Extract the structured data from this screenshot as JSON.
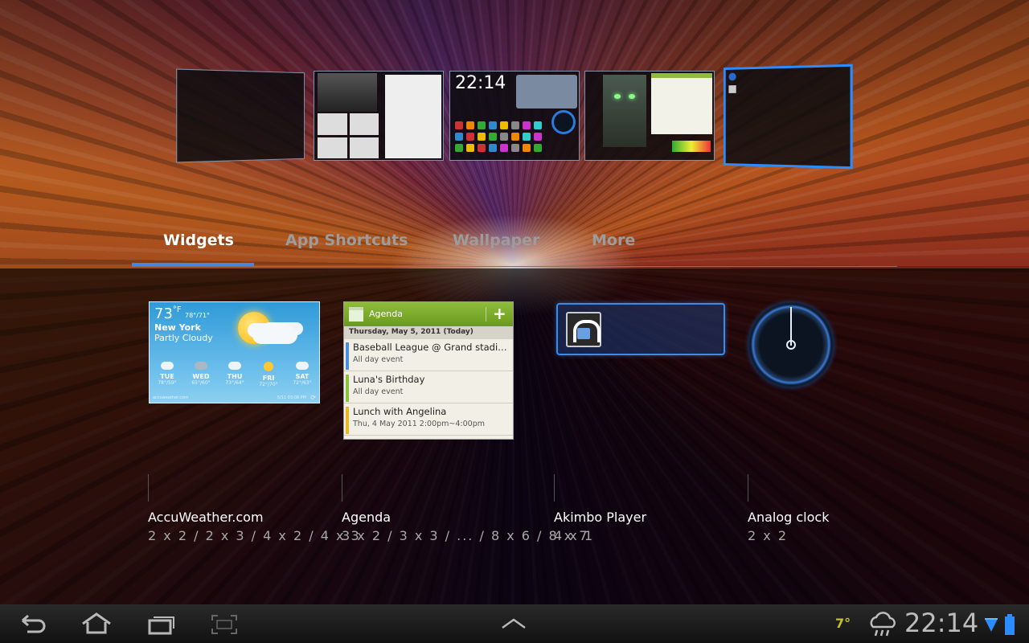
{
  "tabs": [
    {
      "label": "Widgets",
      "active": true
    },
    {
      "label": "App Shortcuts",
      "active": false
    },
    {
      "label": "Wallpaper",
      "active": false
    },
    {
      "label": "More",
      "active": false
    }
  ],
  "home_preview": {
    "clock": "22:14",
    "selected_index": 4
  },
  "widgets": [
    {
      "name": "AccuWeather.com",
      "sizes": "2 x 2 / 2 x 3 / 4 x 2 / 4 x 3"
    },
    {
      "name": "Agenda",
      "sizes": "3 x 2 / 3 x 3 / ... / 8 x 6 / 8 x 7"
    },
    {
      "name": "Akimbo Player",
      "sizes": "4 x 1"
    },
    {
      "name": "Analog clock",
      "sizes": "2 x 2"
    }
  ],
  "weather": {
    "temp": "73",
    "unit": "°F",
    "hilo": "78°/71°",
    "city": "New York",
    "condition": "Partly Cloudy",
    "days": [
      {
        "name": "TUE",
        "hl": "78°/59°",
        "icon": "cloudy"
      },
      {
        "name": "WED",
        "hl": "65°/60°",
        "icon": "storm"
      },
      {
        "name": "THU",
        "hl": "73°/64°",
        "icon": "cloudy"
      },
      {
        "name": "FRI",
        "hl": "72°/70°",
        "icon": "sunny"
      },
      {
        "name": "SAT",
        "hl": "72°/63°",
        "icon": "cloudy"
      }
    ],
    "footer_left": "accuweather.com",
    "footer_right": "5/11 03:08 PM"
  },
  "agenda": {
    "title": "Agenda",
    "add_label": "+",
    "date_header": "Thursday, May 5, 2011 (Today)",
    "events": [
      {
        "title": "Baseball League @ Grand stadiu...",
        "sub": "All day event",
        "color": "#4a90e2"
      },
      {
        "title": "Luna's Birthday",
        "sub": "All day event",
        "color": "#8bc43a"
      },
      {
        "title": "Lunch with Angelina",
        "sub": "Thu, 4 May 2011 2:00pm~4:00pm",
        "color": "#e8b820"
      }
    ]
  },
  "status_bar": {
    "temperature": "7°",
    "time": "22:14",
    "accent": "#2a8cff"
  },
  "nav_icons": [
    "back-icon",
    "home-icon",
    "recent-apps-icon",
    "screenshot-icon",
    "up-arrow-icon"
  ],
  "status_icons": [
    "weather-rain-icon",
    "wifi-icon",
    "battery-icon"
  ]
}
